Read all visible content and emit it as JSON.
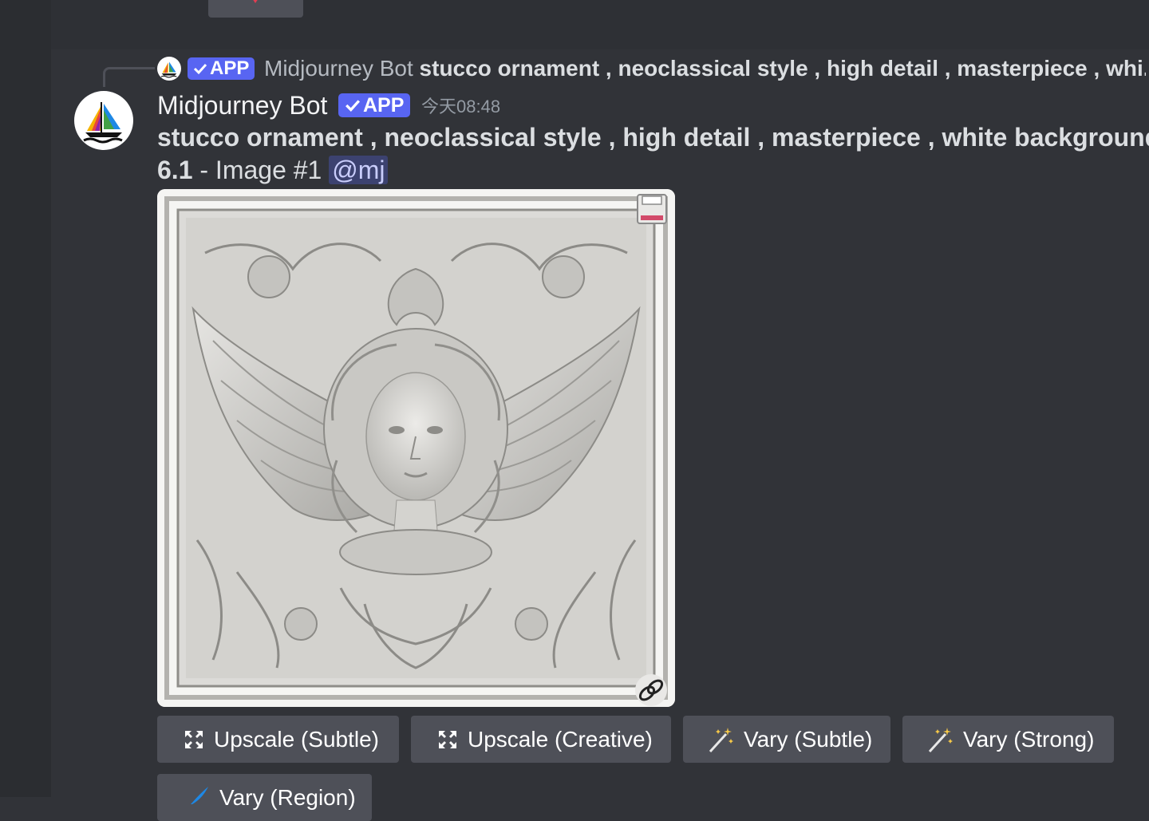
{
  "reply": {
    "badge_label": "APP",
    "author": "Midjourney Bot",
    "prompt_preview": "stucco ornament , neoclassical style , high detail , masterpiece , whi..."
  },
  "message": {
    "author": "Midjourney Bot",
    "badge_label": "APP",
    "timestamp": "今天08:48",
    "prompt": "stucco ornament , neoclassical style , high detail , masterpiece , white background -",
    "version": "6.1",
    "separator": " - ",
    "image_label": "Image #1",
    "mention": "@mj"
  },
  "image": {
    "subject": "stucco relief of winged angel face with acanthus scrollwork, white background"
  },
  "buttons": {
    "upscale_subtle": "Upscale (Subtle)",
    "upscale_creative": "Upscale (Creative)",
    "vary_subtle": "Vary (Subtle)",
    "vary_strong": "Vary (Strong)",
    "vary_region": "Vary (Region)"
  },
  "colors": {
    "background": "#313338",
    "button": "#4e5058",
    "badge": "#5865f2",
    "mention_bg": "#3c4270"
  },
  "icons": [
    "heart-icon",
    "verified-check-icon",
    "sailboat-logo-icon",
    "save-icon",
    "link-icon",
    "expand-icon",
    "magic-wand-icon",
    "brush-icon"
  ]
}
